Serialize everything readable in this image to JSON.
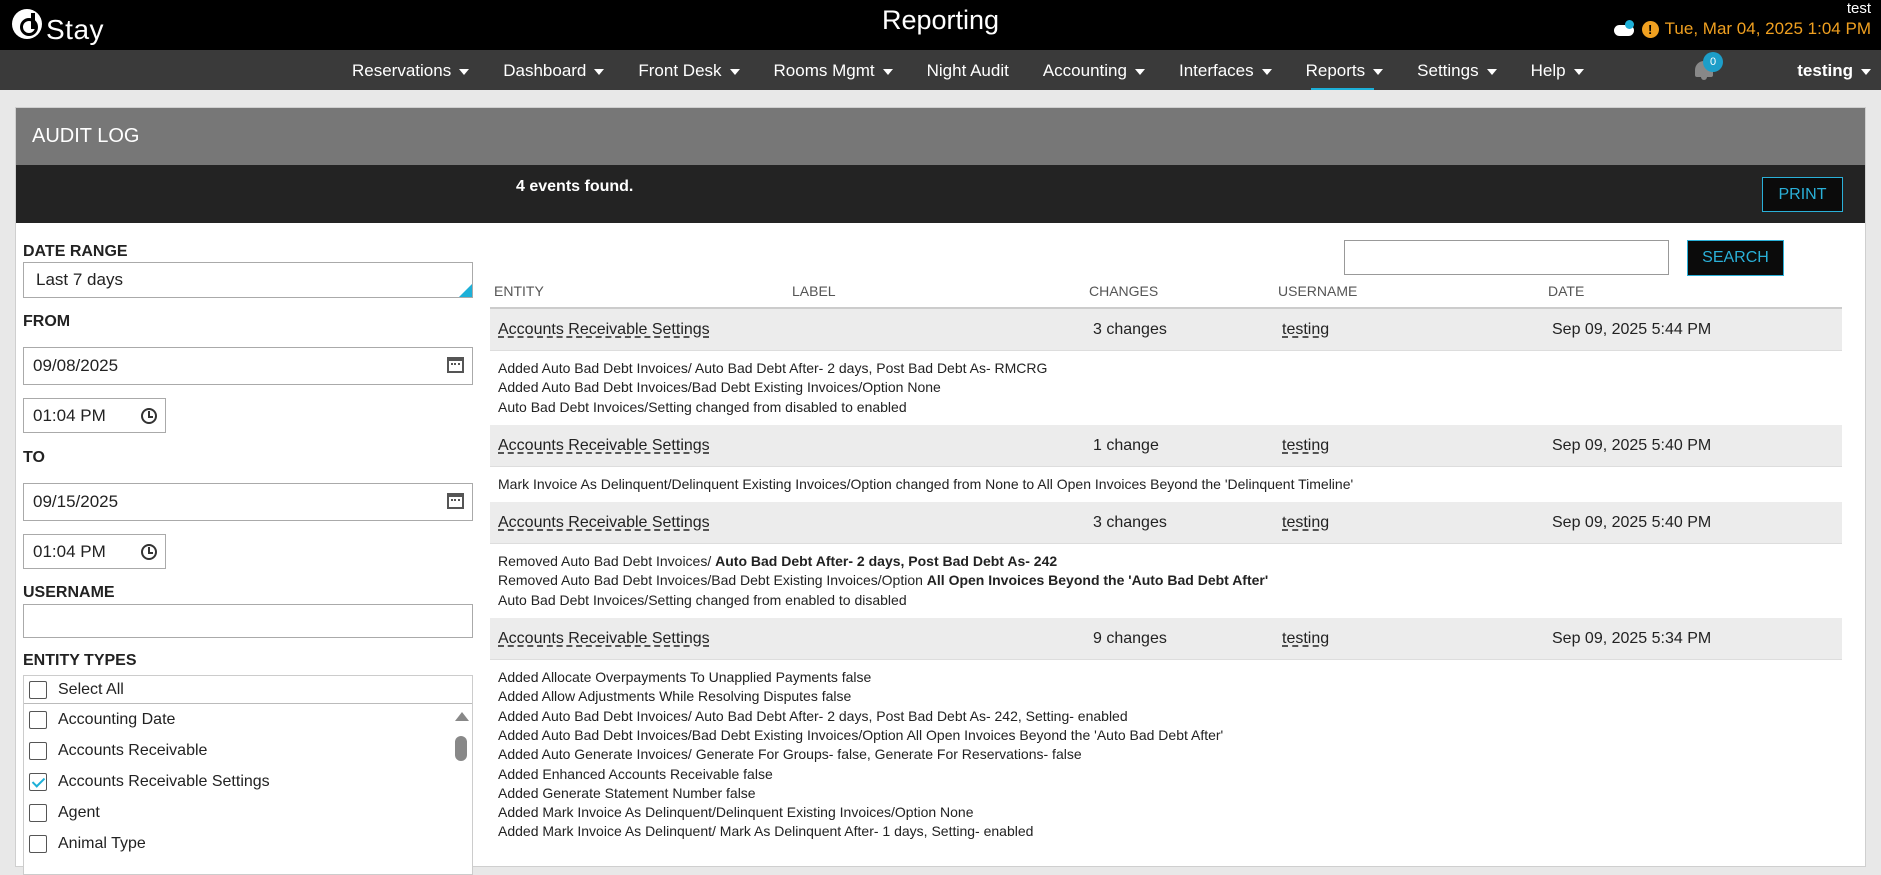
{
  "topbar": {
    "brand": "Stay",
    "title": "Reporting",
    "user_small": "test",
    "datetime": "Tue, Mar 04, 2025 1:04 PM",
    "alert": "!"
  },
  "nav": {
    "items": [
      {
        "label": "Reservations",
        "caret": true
      },
      {
        "label": "Dashboard",
        "caret": true
      },
      {
        "label": "Front Desk",
        "caret": true
      },
      {
        "label": "Rooms Mgmt",
        "caret": true
      },
      {
        "label": "Night Audit",
        "caret": false
      },
      {
        "label": "Accounting",
        "caret": true
      },
      {
        "label": "Interfaces",
        "caret": true
      },
      {
        "label": "Reports",
        "caret": true,
        "active": true
      },
      {
        "label": "Settings",
        "caret": true
      },
      {
        "label": "Help",
        "caret": true
      }
    ],
    "notifications": "0",
    "user": "testing"
  },
  "panel": {
    "title": "AUDIT LOG",
    "events_found": "4 events found.",
    "print_label": "PRINT"
  },
  "filter": {
    "date_range_label": "DATE RANGE",
    "date_range_value": "Last 7 days",
    "from_label": "FROM",
    "from_date": "09/08/2025",
    "from_time": "01:04 PM",
    "to_label": "TO",
    "to_date": "09/15/2025",
    "to_time": "01:04 PM",
    "username_label": "USERNAME",
    "username_value": "",
    "entity_types_label": "ENTITY TYPES",
    "select_all_label": "Select All",
    "entity_types": [
      {
        "label": "Accounting Date",
        "checked": false
      },
      {
        "label": "Accounts Receivable",
        "checked": false
      },
      {
        "label": "Accounts Receivable Settings",
        "checked": true
      },
      {
        "label": "Agent",
        "checked": false
      },
      {
        "label": "Animal Type",
        "checked": false
      }
    ]
  },
  "search": {
    "value": "",
    "button_label": "SEARCH"
  },
  "table": {
    "columns": {
      "entity": "ENTITY",
      "label": "LABEL",
      "changes": "CHANGES",
      "username": "USERNAME",
      "date": "DATE"
    },
    "events": [
      {
        "entity": "Accounts Receivable Settings",
        "changes": "3 changes",
        "username": "testing",
        "date": "Sep 09, 2025 5:44 PM",
        "details": [
          [
            {
              "t": "Added Auto Bad Debt Invoices/ Auto Bad Debt After- 2 days, Post Bad Debt As- RMCRG",
              "b": false
            }
          ],
          [
            {
              "t": "Added Auto Bad Debt Invoices/Bad Debt Existing Invoices/Option None",
              "b": false
            }
          ],
          [
            {
              "t": "Auto Bad Debt Invoices/Setting changed from disabled to enabled",
              "b": false
            }
          ]
        ]
      },
      {
        "entity": "Accounts Receivable Settings",
        "changes": "1 change",
        "username": "testing",
        "date": "Sep 09, 2025 5:40 PM",
        "details": [
          [
            {
              "t": "Mark Invoice As Delinquent/Delinquent Existing Invoices/Option changed from None to All Open Invoices Beyond the 'Delinquent Timeline'",
              "b": false
            }
          ]
        ]
      },
      {
        "entity": "Accounts Receivable Settings",
        "changes": "3 changes",
        "username": "testing",
        "date": "Sep 09, 2025 5:40 PM",
        "details": [
          [
            {
              "t": "Removed Auto Bad Debt Invoices/ ",
              "b": false
            },
            {
              "t": "Auto Bad Debt After- 2 days, Post Bad Debt As- 242",
              "b": true
            }
          ],
          [
            {
              "t": "Removed Auto Bad Debt Invoices/Bad Debt Existing Invoices/Option ",
              "b": false
            },
            {
              "t": "All Open Invoices Beyond the 'Auto Bad Debt After'",
              "b": true
            }
          ],
          [
            {
              "t": "Auto Bad Debt Invoices/Setting changed from enabled to disabled",
              "b": false
            }
          ]
        ]
      },
      {
        "entity": "Accounts Receivable Settings",
        "changes": "9 changes",
        "username": "testing",
        "date": "Sep 09, 2025 5:34 PM",
        "details": [
          [
            {
              "t": "Added Allocate Overpayments To Unapplied Payments false",
              "b": false
            }
          ],
          [
            {
              "t": "Added Allow Adjustments While Resolving Disputes false",
              "b": false
            }
          ],
          [
            {
              "t": "Added Auto Bad Debt Invoices/ Auto Bad Debt After- 2 days, Post Bad Debt As- 242, Setting- enabled",
              "b": false
            }
          ],
          [
            {
              "t": "Added Auto Bad Debt Invoices/Bad Debt Existing Invoices/Option All Open Invoices Beyond the 'Auto Bad Debt After'",
              "b": false
            }
          ],
          [
            {
              "t": "Added Auto Generate Invoices/ Generate For Groups- false, Generate For Reservations- false",
              "b": false
            }
          ],
          [
            {
              "t": "Added Enhanced Accounts Receivable false",
              "b": false
            }
          ],
          [
            {
              "t": "Added Generate Statement Number false",
              "b": false
            }
          ],
          [
            {
              "t": "Added Mark Invoice As Delinquent/Delinquent Existing Invoices/Option None",
              "b": false
            }
          ],
          [
            {
              "t": "Added Mark Invoice As Delinquent/ Mark As Delinquent After- 1 days, Setting- enabled",
              "b": false
            }
          ]
        ]
      }
    ]
  },
  "colors": {
    "accent": "#1db0d8",
    "topbar_bg": "#000000",
    "nav_bg": "#3a3a3a",
    "header_bg": "#777777",
    "clock_orange": "#f0a020"
  }
}
